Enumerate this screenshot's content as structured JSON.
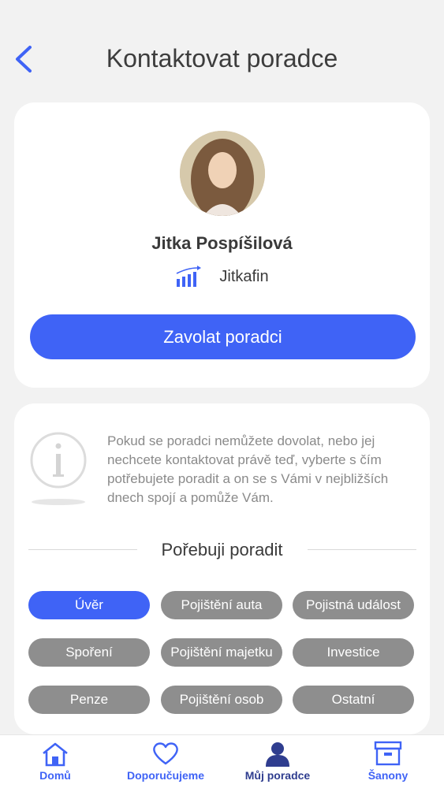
{
  "header": {
    "title": "Kontaktovat poradce",
    "back_icon": "chevron-left-icon"
  },
  "advisor": {
    "name": "Jitka Pospíšilová",
    "company": "Jitkafin",
    "company_icon": "bar-chart-icon",
    "call_button": "Zavolat poradci"
  },
  "help": {
    "info_text": "Pokud se poradci nemůžete dovolat, nebo jej nechcete kontaktovat právě teď, vyberte s čím potřebujete poradit a on se s Vámi v nejbližších dnech spojí a pomůže Vám.",
    "section_title": "Pořebuji poradit",
    "chips": [
      {
        "label": "Úvěr",
        "selected": true
      },
      {
        "label": "Pojištění auta",
        "selected": false
      },
      {
        "label": "Pojistná událost",
        "selected": false
      },
      {
        "label": "Spoření",
        "selected": false
      },
      {
        "label": "Pojištění majetku",
        "selected": false
      },
      {
        "label": "Investice",
        "selected": false
      },
      {
        "label": "Penze",
        "selected": false
      },
      {
        "label": "Pojištění osob",
        "selected": false
      },
      {
        "label": "Ostatní",
        "selected": false
      }
    ]
  },
  "tabbar": {
    "items": [
      {
        "label": "Domů",
        "icon": "home-icon"
      },
      {
        "label": "Doporučujeme",
        "icon": "heart-icon"
      },
      {
        "label": "Můj poradce",
        "icon": "person-icon",
        "active": true
      },
      {
        "label": "Šanony",
        "icon": "archive-box-icon"
      }
    ]
  },
  "colors": {
    "accent": "#3f63f6",
    "chip_inactive": "#8e8e8e",
    "active_tab": "#2f3d8f",
    "background": "#f2f2f2"
  }
}
